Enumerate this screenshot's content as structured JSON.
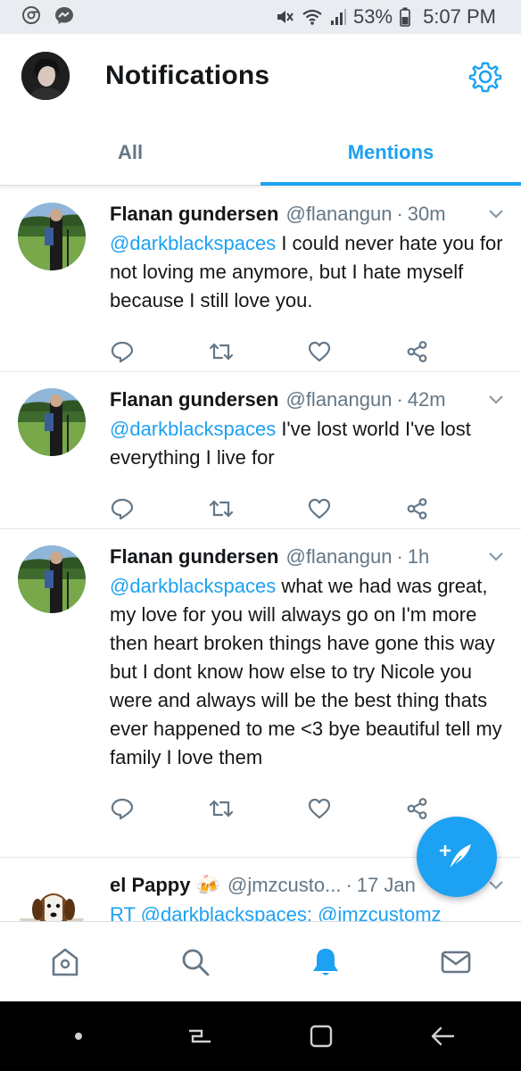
{
  "status_bar": {
    "battery": "53%",
    "time": "5:07 PM"
  },
  "header": {
    "title": "Notifications"
  },
  "tabs": [
    {
      "label": "All",
      "active": false
    },
    {
      "label": "Mentions",
      "active": true
    }
  ],
  "tweets": [
    {
      "name": "Flanan gundersen",
      "handle": "@flanangun",
      "time": "30m",
      "mention": "@darkblackspaces",
      "text": " I could never hate you for not loving me anymore, but I hate myself because I still love you."
    },
    {
      "name": "Flanan gundersen",
      "handle": "@flanangun",
      "time": "42m",
      "mention": "@darkblackspaces",
      "text": " I've lost world I've lost everything I live for"
    },
    {
      "name": "Flanan gundersen",
      "handle": "@flanangun",
      "time": "1h",
      "mention": "@darkblackspaces",
      "text": " what we had was great, my love for you will always go on I'm more then heart broken things have gone this way but I dont know how else to try Nicole you were and always will be the best thing thats ever happened to me <3 bye beautiful tell my family I love them"
    },
    {
      "name": "el Pappy 🍻",
      "handle": "@jmzcusto...",
      "time": "17 Jan",
      "preview": "RT @darkblackspaces: @jmzcustomz"
    }
  ],
  "icons": {
    "reply": "reply-icon",
    "retweet": "retweet-icon",
    "like": "heart-icon",
    "share": "share-icon",
    "compose": "compose-tweet-icon",
    "home": "home-icon",
    "search": "search-icon",
    "notifications": "bell-icon",
    "messages": "mail-icon"
  },
  "colors": {
    "accent": "#1da1f2",
    "text_primary": "#14171a",
    "text_secondary": "#657786"
  }
}
